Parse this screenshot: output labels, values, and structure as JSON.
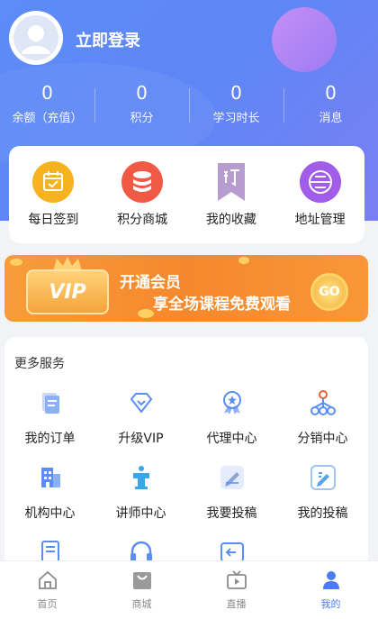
{
  "header": {
    "login_text": "立即登录"
  },
  "stats": [
    {
      "value": "0",
      "label": "余额（充值）"
    },
    {
      "value": "0",
      "label": "积分"
    },
    {
      "value": "0",
      "label": "学习时长"
    },
    {
      "value": "0",
      "label": "消息"
    }
  ],
  "quick_actions": [
    {
      "label": "每日签到",
      "icon": "calendar-check-icon"
    },
    {
      "label": "积分商城",
      "icon": "database-icon"
    },
    {
      "label": "我的收藏",
      "icon": "bookmark-icon"
    },
    {
      "label": "地址管理",
      "icon": "address-icon"
    }
  ],
  "banner": {
    "vip_text": "VIP",
    "title": "开通会员",
    "subtitle": "享全场课程免费观看",
    "go_text": "GO"
  },
  "services": {
    "title": "更多服务",
    "items": [
      {
        "label": "我的订单",
        "icon": "document-icon"
      },
      {
        "label": "升级VIP",
        "icon": "diamond-icon"
      },
      {
        "label": "代理中心",
        "icon": "badge-icon"
      },
      {
        "label": "分销中心",
        "icon": "network-icon"
      },
      {
        "label": "机构中心",
        "icon": "building-icon"
      },
      {
        "label": "讲师中心",
        "icon": "lectern-icon"
      },
      {
        "label": "我要投稿",
        "icon": "edit-note-icon"
      },
      {
        "label": "我的投稿",
        "icon": "edit-box-icon"
      },
      {
        "label": "",
        "icon": "exam-icon"
      },
      {
        "label": "",
        "icon": "headset-icon"
      },
      {
        "label": "",
        "icon": "back-arrow-icon"
      }
    ]
  },
  "tabbar": [
    {
      "label": "首页",
      "icon": "home-icon",
      "active": false
    },
    {
      "label": "商城",
      "icon": "shop-bag-icon",
      "active": false
    },
    {
      "label": "直播",
      "icon": "tv-icon",
      "active": false
    },
    {
      "label": "我的",
      "icon": "user-icon",
      "active": true
    }
  ],
  "colors": {
    "header_start": "#5c8cf7",
    "header_end": "#7b7ff3",
    "accent": "#4d7cf2",
    "banner_orange": "#f5882c"
  }
}
